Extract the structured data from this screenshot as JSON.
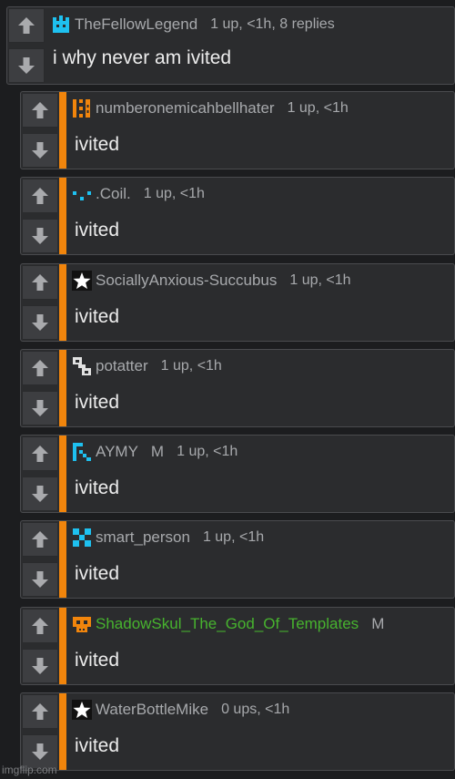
{
  "post": {
    "username": "TheFellowLegend",
    "meta": "1 up, <1h, 8 replies",
    "text": "i why never am ivited",
    "avatar_icon": "cyan-crown-avatar-icon"
  },
  "replies": [
    {
      "username": "numberonemicahbellhater",
      "meta": "1 up, <1h",
      "text": "ivited",
      "avatar_icon": "orange-pattern-avatar-icon"
    },
    {
      "username": ".Coil.",
      "meta": "1 up, <1h",
      "text": "ivited",
      "avatar_icon": "cyan-dots-avatar-icon"
    },
    {
      "username": "SociallyAnxious-Succubus",
      "meta": "1 up, <1h",
      "text": "ivited",
      "avatar_icon": "white-star-avatar-icon"
    },
    {
      "username": "potatter",
      "meta": "1 up, <1h",
      "text": "ivited",
      "avatar_icon": "gray-block-avatar-icon"
    },
    {
      "username": "AYMY",
      "mod": "M",
      "meta": "1 up, <1h",
      "text": "ivited",
      "avatar_icon": "cyan-pixel-avatar-icon"
    },
    {
      "username": "smart_person",
      "meta": "1 up, <1h",
      "text": "ivited",
      "avatar_icon": "cyan-x-avatar-icon"
    },
    {
      "username": "ShadowSkul_The_God_Of_Templates",
      "mod": "M",
      "meta": "",
      "text": "ivited",
      "avatar_icon": "orange-skull-avatar-icon",
      "name_color": "#47b32e"
    },
    {
      "username": "WaterBottleMike",
      "meta": "0 ups, <1h",
      "text": "ivited",
      "avatar_icon": "white-star-avatar-icon"
    }
  ],
  "watermark": "imgflip.com",
  "colors": {
    "background": "#1c1d1f",
    "panel": "#2b2c2e",
    "accent": "#f1850c",
    "username": "#a7a9ac",
    "mod_username": "#47b32e",
    "text": "#ededed"
  }
}
